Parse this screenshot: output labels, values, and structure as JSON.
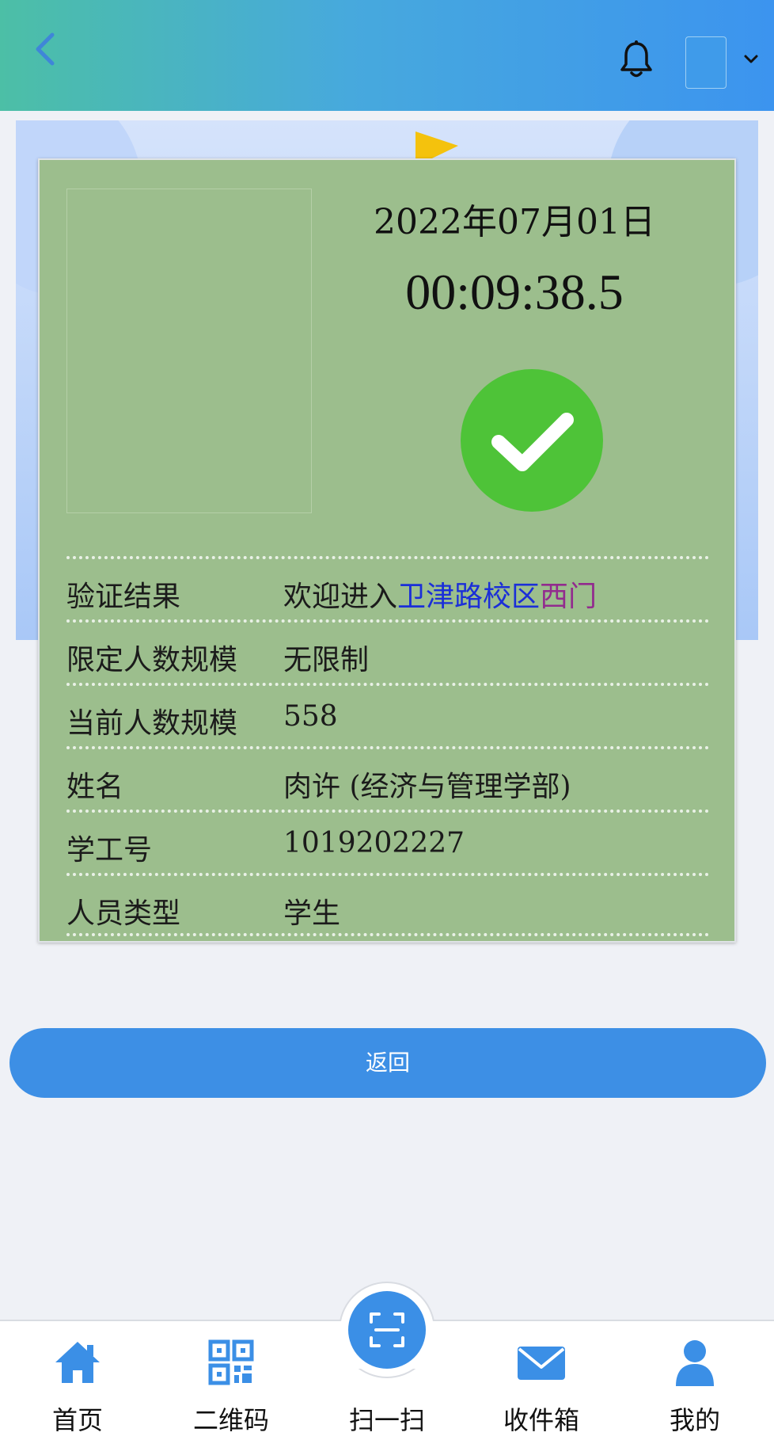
{
  "header": {
    "back_icon": "chevron-left-icon",
    "bell_icon": "bell-icon",
    "dropdown_icon": "chevron-down-icon"
  },
  "card": {
    "date": "2022年07月01日",
    "time": "00:09:38.5",
    "status_icon": "check-circle-icon",
    "rows": [
      {
        "label": "验证结果",
        "value_prefix": "欢迎进入",
        "value_blue": "卫津路校区",
        "value_purple": "西门"
      },
      {
        "label": "限定人数规模",
        "value": "无限制"
      },
      {
        "label": "当前人数规模",
        "value": "558"
      },
      {
        "label": "姓名",
        "value": "肉许 (经济与管理学部)"
      },
      {
        "label": "学工号",
        "value": "1019202227"
      },
      {
        "label": "人员类型",
        "value": "学生"
      }
    ]
  },
  "return_button": {
    "label": "返回"
  },
  "colors": {
    "header_start": "#4cbfa6",
    "header_end": "#3c94ef",
    "card_bg": "#9cbe8d",
    "success": "#4ec338",
    "primary": "#3d8fe5",
    "campus_text": "#1b2fd8",
    "gate_text": "#922b8e"
  },
  "nav": {
    "items": [
      {
        "label": "首页",
        "icon": "home-icon"
      },
      {
        "label": "二维码",
        "icon": "qr-code-icon"
      },
      {
        "label": "扫一扫",
        "icon": "scan-icon"
      },
      {
        "label": "收件箱",
        "icon": "mail-icon"
      },
      {
        "label": "我的",
        "icon": "user-icon"
      }
    ]
  }
}
